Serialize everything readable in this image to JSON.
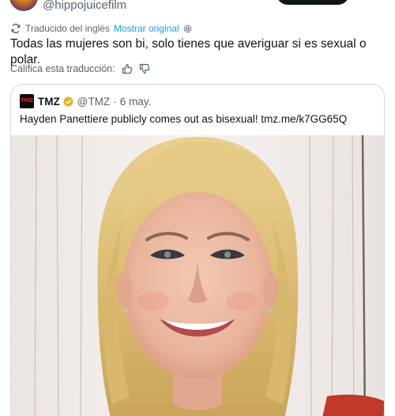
{
  "author": {
    "handle": "@hippojuicefilm"
  },
  "translation": {
    "status": "Traducido del inglés",
    "show_original": "Mostrar original"
  },
  "tweet": {
    "text": "Todas las mujeres son bi, solo tienes que averiguar si es sexual o polar."
  },
  "rate": {
    "label": "Califica esta traducción:"
  },
  "quote": {
    "logo_text": "TMZ",
    "name": "TMZ",
    "handle": "@TMZ",
    "separator": "·",
    "date": "6 may.",
    "text": "Hayden Panettiere publicly comes out as bisexual! tmz.me/k7GG65Q"
  },
  "colors": {
    "link": "#1d9bf0",
    "muted": "#536471",
    "text": "#0f1419",
    "verified_gold": "#e2b719",
    "tmz_red": "#e0201b"
  },
  "icons": {
    "translate": "translate-icon",
    "settings": "gear-icon",
    "thumb_up": "thumbs-up-icon",
    "thumb_down": "thumbs-down-icon",
    "verified": "verified-badge-icon"
  }
}
